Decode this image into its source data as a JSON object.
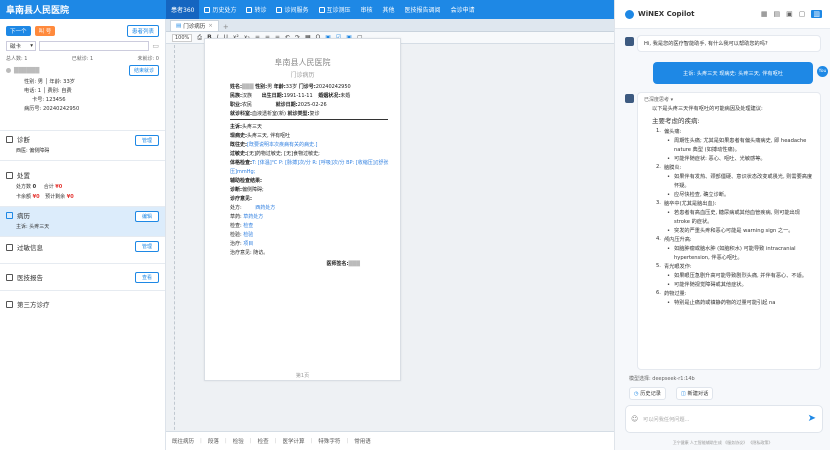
{
  "topbar": {
    "hospital": "阜南县人民医院",
    "nav": [
      "患者360",
      "历史处方",
      "转诊",
      "诊间服务",
      "互诊测压",
      "审核",
      "其他",
      "医技报告调阅",
      "会诊申请"
    ]
  },
  "left": {
    "next_label": "下一个",
    "call_label": "叫 号",
    "patient_list_label": "患者列表",
    "card_select": "磁卡",
    "stats": {
      "total": "总人数: 1",
      "done": "已就诊: 1",
      "pending": "未就诊: 0"
    },
    "end_visit_label": "结束就诊",
    "patient": {
      "name": "██████",
      "gender_age": "性别: 男 │ 年龄: 33岁",
      "nation": "电话: 1 │ 费别: 自费",
      "card_no": "卡号: 123456",
      "record_no": "病历号: 20240242950"
    },
    "sections": {
      "diagnosis": {
        "title": "诊断",
        "btn": "管理",
        "detail": "西医: 偏侧障碍"
      },
      "prescription": {
        "title": "处置",
        "detail1a": "处方数",
        "detail1b": "0",
        "detail1c": "合计",
        "detail1d": "¥0",
        "detail2a": "卡余额",
        "detail2b": "¥0",
        "detail2c": "预计剩余",
        "detail2d": "¥0"
      },
      "record": {
        "title": "病历",
        "btn": "编辑",
        "detail": "主诉: 头疼三天"
      },
      "allergy": {
        "title": "过敏信息",
        "btn": "管理"
      },
      "report": {
        "title": "医技报告",
        "btn": "查看"
      },
      "third": {
        "title": "第三方诊疗"
      }
    }
  },
  "center": {
    "tab": "门诊病历",
    "zoom": "100%",
    "doc": {
      "hospital": "阜南县人民医院",
      "subtitle": "门诊病历",
      "l1a": "姓名:",
      "l1b": "███",
      "l1c": "性别:",
      "l1d": "男",
      "l1e": "年龄:",
      "l1f": "33岁",
      "l1g": "门诊号:",
      "l1h": "20240242950",
      "l2a": "民族:",
      "l2b": "汉族",
      "l2c": "出生日期:",
      "l2d": "1991-11-11",
      "l2e": "婚姻状况:",
      "l2f": "未婚",
      "l3a": "职业:",
      "l3b": "农民",
      "l3c": "就诊日期:",
      "l3d": "2025-02-26",
      "l4a": "就诊科室:",
      "l4b": "血液透析室(新)",
      "l4c": "就诊类型:",
      "l4d": "复诊",
      "chief_lbl": "主诉:",
      "chief": "头疼三天",
      "present_lbl": "现病史:",
      "present": "头疼三天, 伴有呕吐",
      "past_lbl": "既往史:",
      "past": "[既要说明本次疾病有关的病史.]",
      "allergy_lbl": "过敏史:",
      "allergy": "[无]药物过敏史; [无]食物过敏史;",
      "exam_lbl": "体格检查:",
      "exam": "T: [体温]℃ P: [脉搏]次/分 R: [呼吸]次/分 BP: [收缩压]/[舒张压]mmHg;",
      "aux_lbl": "辅助检查结果:",
      "diag_lbl": "诊断:",
      "diag": "偏侧障碍;",
      "opinion_lbl": "诊疗意见:",
      "rx_lbl": "处方:",
      "rx": "西药处方",
      "herbal_lbl": "草药:",
      "herbal": "草药处方",
      "check_lbl": "检查:",
      "check": "检查",
      "test_lbl": "检验:",
      "test": "检验",
      "treat_lbl": "治疗:",
      "treat": "项目",
      "advice_lbl": "治疗意见:",
      "advice": "随访。",
      "sign_lbl": "医师签名:",
      "sign": "███",
      "page": "第1页"
    },
    "bottom": [
      "既往病历",
      "段落",
      "检验",
      "检查",
      "医学计算",
      "特殊字符",
      "常用语"
    ]
  },
  "copilot": {
    "title": "WiNEX Copilot",
    "greeting": "Hi, 我是您的医疗智能助手, 有什么我可以帮助您的吗?",
    "user_msg": "主诉: 头疼三天 现病史: 头疼三天, 伴有呕吐",
    "user_avatar": "You",
    "thinking": "已深度思考",
    "intro": "以下是头疼三天伴有呕吐的可能病因及处理建议:",
    "heading": "主要考虑的疾病:",
    "items": [
      {
        "n": "1.",
        "t": "偏头痛:",
        "s": [
          "周期性头痛; 尤其是如果患者有偏头痛病史, 即 headache nature 典型 (如搏动性痛)。",
          "可能伴随症状: 恶心、呕吐、光敏感等。"
        ]
      },
      {
        "n": "2.",
        "t": "脑膜炎:",
        "s": [
          "如果伴有发热、颈部僵硬、意识状态改变或畏光, 则需要高度怀疑。",
          "应尽快检查, 确立诊断。"
        ]
      },
      {
        "n": "3.",
        "t": "脑卒中(尤其是脑出血):",
        "s": [
          "若患者有高血压史, 糖尿病或其他血管疾病, 则可能出现 stroke 的症状。",
          "突发的严重头疼和恶心可能是 warning sign 之一。"
        ]
      },
      {
        "n": "4.",
        "t": "颅内压升高:",
        "s": [
          "如脑肿瘤或脑水肿 (如脑积水) 可能导致 intracranial hypertension, 伴恶心呕吐。"
        ]
      },
      {
        "n": "5.",
        "t": "青光眼发作:",
        "s": [
          "如果眼压急剧升高可能导致剧烈头痛, 并伴有恶心、不适。",
          "可能伴随视觉障碍或其他症状。"
        ]
      },
      {
        "n": "6.",
        "t": "药物过量:",
        "s": [
          "特别是止痛药或镇静药物的过量可能引起 na"
        ]
      }
    ],
    "model": "模型选择: deepseek-r1:14b",
    "history": "历史记录",
    "new_chat": "新建对话",
    "placeholder": "可以问我任何问题...",
    "footer": "卫宁健康 人工智能辅助生成 《服务协议》 《隐私政策》"
  }
}
